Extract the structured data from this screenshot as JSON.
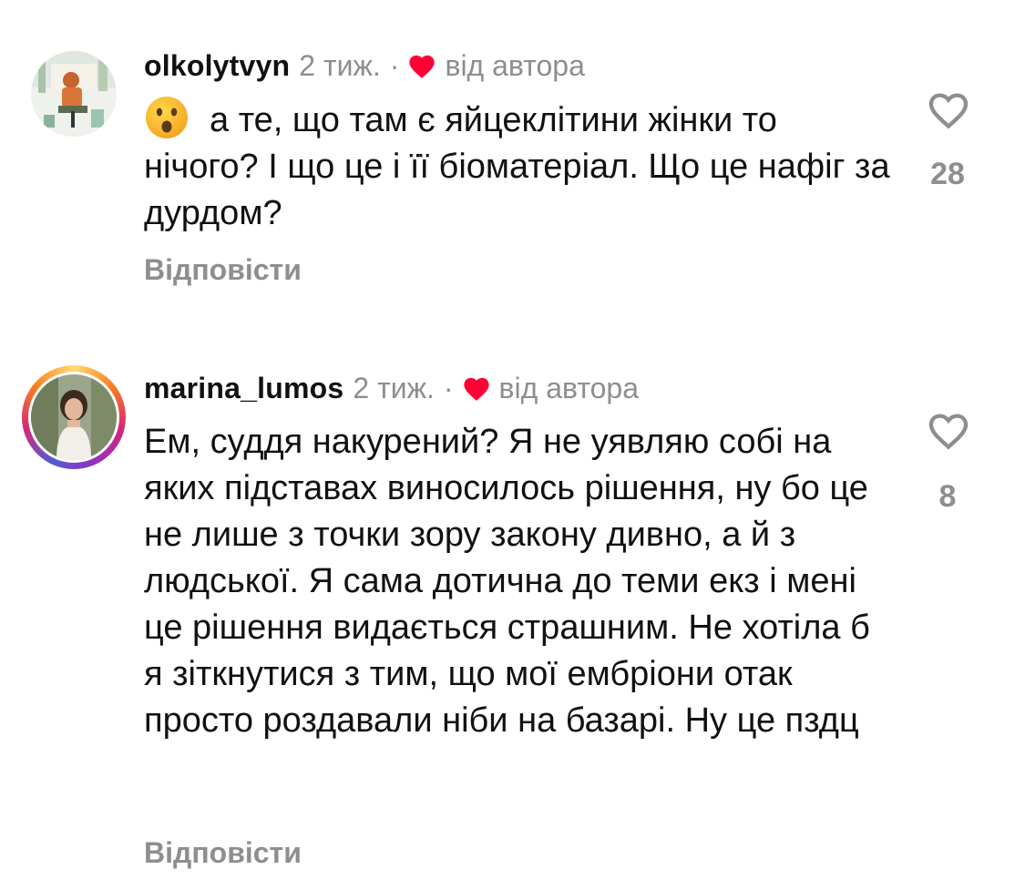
{
  "comments": [
    {
      "username": "olkolytvyn",
      "time": "2 тиж.",
      "separator": "·",
      "by_author": "від автора",
      "text": "а те, що там є яйцеклітини жінки то нічого? І що це і її біоматеріал. Що це нафіг за дурдом?",
      "emoji": "hushed-face-emoji",
      "reply_label": "Відповісти",
      "likes": "28",
      "avatar_has_story_ring": false
    },
    {
      "username": "marina_lumos",
      "time": "2 тиж.",
      "separator": "·",
      "by_author": "від автора",
      "text": "Ем, суддя накурений? Я не уявляю собі на яких підставах виносилось рішення, ну бо це не лише з точки зору закону дивно, а й з людської. Я сама дотична до теми екз і мені це рішення видається страшним. Не хотіла б я зіткнутися з тим, що мої ембріони отак просто роздавали ніби на базарі. Ну це пздц",
      "reply_label": "Відповісти",
      "likes": "8",
      "avatar_has_story_ring": true
    }
  ],
  "colors": {
    "muted": "#8e8e8e",
    "text": "#111111",
    "heart_red": "#ff0034"
  }
}
